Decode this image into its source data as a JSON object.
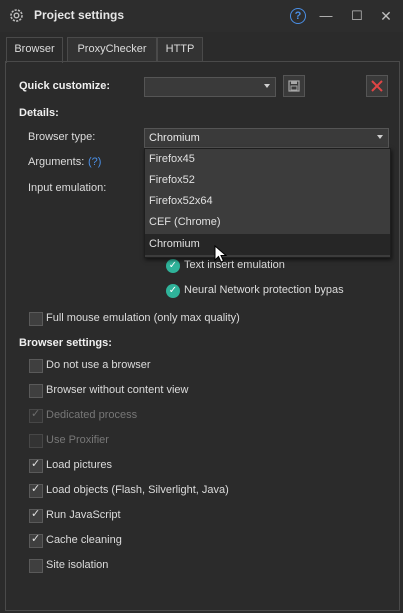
{
  "window": {
    "title": "Project settings",
    "help_glyph": "?",
    "icons": [
      "gear-icon",
      "help-icon",
      "minimize-icon",
      "maximize-icon",
      "close-icon"
    ]
  },
  "tabs": [
    {
      "label": "Browser",
      "active": true
    },
    {
      "label": "ProxyChecker",
      "active": false
    },
    {
      "label": "HTTP",
      "active": false
    }
  ],
  "quick_customize": {
    "label": "Quick customize:",
    "value": ""
  },
  "details": {
    "heading": "Details:",
    "browser_type_label": "Browser type:",
    "browser_type_value": "Chromium",
    "arguments_label": "Arguments:",
    "arguments_help": "(?)",
    "input_emulation_label": "Input emulation:"
  },
  "browser_dropdown": {
    "options": [
      "Firefox45",
      "Firefox52",
      "Firefox52x64",
      "CEF (Chrome)",
      "Chromium"
    ],
    "selected": "Chromium"
  },
  "emulation_options": [
    {
      "label": "Text insert emulation",
      "enabled": true
    },
    {
      "label": "Neural Network protection bypas",
      "enabled": true
    }
  ],
  "full_mouse_emulation": {
    "label": "Full mouse emulation (only max quality)",
    "checked": false
  },
  "browser_settings": {
    "heading": "Browser settings:",
    "items": [
      {
        "label": "Do not use a browser",
        "checked": false,
        "disabled": false
      },
      {
        "label": "Browser without content view",
        "checked": false,
        "disabled": false
      },
      {
        "label": "Dedicated process",
        "checked": true,
        "disabled": true
      },
      {
        "label": "Use Proxifier",
        "checked": false,
        "disabled": true
      },
      {
        "label": "Load pictures",
        "checked": true,
        "disabled": false
      },
      {
        "label": "Load objects (Flash, Silverlight, Java)",
        "checked": true,
        "disabled": false
      },
      {
        "label": "Run JavaScript",
        "checked": true,
        "disabled": false
      },
      {
        "label": "Cache cleaning",
        "checked": true,
        "disabled": false
      },
      {
        "label": "Site isolation",
        "checked": false,
        "disabled": false
      }
    ]
  },
  "colors": {
    "accent": "#4a8fe6",
    "green": "#2fb39a",
    "close_red": "#e04545",
    "background": "#2b2b2b"
  }
}
